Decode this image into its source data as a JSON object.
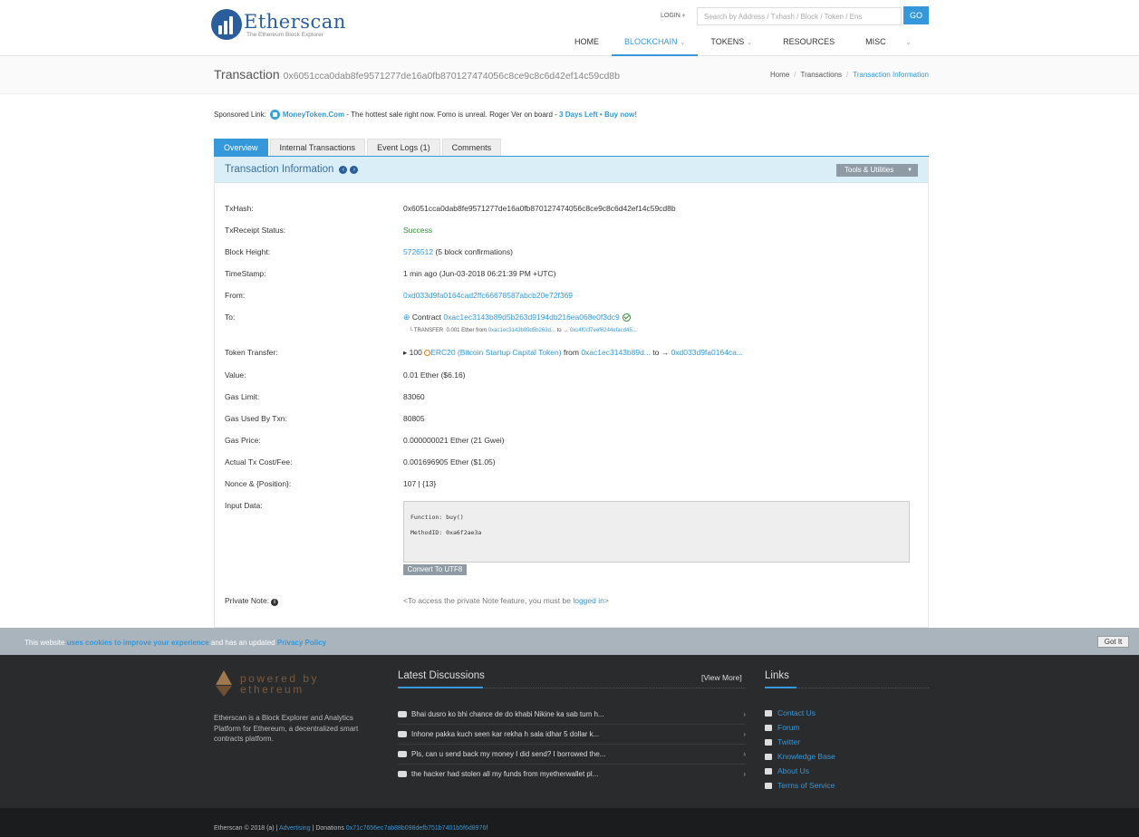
{
  "header": {
    "logo_title": "Etherscan",
    "logo_sub": "The Ethereum Block Explorer",
    "login": "LOGIN",
    "search_placeholder": "Search by Address / Txhash / Block / Token / Ens",
    "go": "GO",
    "nav": [
      {
        "label": "HOME"
      },
      {
        "label": "BLOCKCHAIN"
      },
      {
        "label": "TOKENS"
      },
      {
        "label": "RESOURCES"
      },
      {
        "label": "MISC"
      }
    ]
  },
  "subheader": {
    "title": "Transaction",
    "hash": "0x6051cca0dab8fe9571277de16a0fb870127474056c8ce9c8c6d42ef14c59cd8b",
    "breadcrumb": [
      "Home",
      "Transactions",
      "Transaction Information"
    ]
  },
  "sponsored": {
    "label": "Sponsored Link:",
    "name": "MoneyToken.Com",
    "text": " - The hottest sale right now. Fomo is unreal. Roger Ver on board - ",
    "cta": "3 Days Left • Buy now!"
  },
  "tabs": [
    "Overview",
    "Internal Transactions",
    "Event Logs (1)",
    "Comments"
  ],
  "panel": {
    "title": "Transaction Information",
    "tools": "Tools & Utilities"
  },
  "tx": {
    "labels": {
      "txhash": "TxHash:",
      "status": "TxReceipt Status:",
      "block": "Block Height:",
      "timestamp": "TimeStamp:",
      "from": "From:",
      "to": "To:",
      "token_transfer": "Token Transfer:",
      "value": "Value:",
      "gas_limit": "Gas Limit:",
      "gas_used": "Gas Used By Txn:",
      "gas_price": "Gas Price:",
      "fee": "Actual Tx Cost/Fee:",
      "nonce": "Nonce & {Position}:",
      "input": "Input Data:",
      "private_note": "Private Note:"
    },
    "txhash": "0x6051cca0dab8fe9571277de16a0fb870127474056c8ce9c8c6d42ef14c59cd8b",
    "status": "Success",
    "block_number": "5726512",
    "block_confirmations": " (5 block confirmations)",
    "timestamp": "1 min ago (Jun-03-2018 06:21:39 PM +UTC)",
    "from": "0xd033d9fa0164cad2ffc66678587abcb20e72f369",
    "to_prefix": " Contract ",
    "to": "0xac1ec3143b89d5b263d9194db216ea068e0f3dc9",
    "internal_transfer_label": "└ TRANSFER  0.001 Ether from ",
    "internal_from": "0xac1ec3143b89d5b263d...",
    "internal_to_label": " to → ",
    "internal_to": "0xc4f0cf7eef6244efacd45...",
    "token_amount": "▸ 100 ",
    "token_name": "ERC20 (Bitcoin Startup Capital Token)",
    "token_from_label": " from ",
    "token_from": "0xac1ec3143b89d...",
    "token_to_label": " to → ",
    "token_to": "0xd033d9fa0164ca...",
    "value": "0.01 Ether ($6.16)",
    "gas_limit": "83060",
    "gas_used": "80805",
    "gas_price": "0.000000021 Ether (21 Gwei)",
    "fee": "0.001696905 Ether ($1.05)",
    "nonce": "107 | {13}",
    "input_function": "Function: buy()",
    "input_method": "MethodID: 0xa6f2ae3a",
    "convert_btn": "Convert To UTF8",
    "private_note_text": "<To access the private Note feature, you must be ",
    "private_note_link": "logged in",
    "private_note_end": ">"
  },
  "cookie": {
    "prefix": "This website ",
    "link1": "uses cookies to improve your experience",
    "middle": " and has an updated ",
    "link2": "Privacy Policy",
    "button": "Got It"
  },
  "footer": {
    "eth_line1": "powered by",
    "eth_line2": "ethereum",
    "description": "Etherscan is a Block Explorer and Analytics Platform for Ethereum, a decentralized smart contracts platform.",
    "latest_title": "Latest Discussions",
    "view_more": "[View More]",
    "discussions": [
      "Bhai dusro ko bhi chance de do khabi Nikine ka sab tum h...",
      "Inhone pakka kuch seen kar rekha h sala idhar 5 dollar k...",
      "Pls, can u send back my money I did send? I borrowed the...",
      "the hacker had stolen all my funds from myetherwallet pl..."
    ],
    "links_title": "Links",
    "links": [
      "Contact Us",
      "Forum",
      "Twitter",
      "Knowledge Base",
      "About Us",
      "Terms of Service"
    ],
    "copyright": "Etherscan © 2018 (a) | ",
    "advertising": "Advertising",
    "donations_label": " | Donations ",
    "donations": "0x71c7656ec7ab88b098defb751b7401b5f6d8976f"
  },
  "colors": {
    "accent": "#3498db",
    "success": "#2e8b2e",
    "footer_bg": "#2a2b2d",
    "panel_head": "#daeef8"
  }
}
